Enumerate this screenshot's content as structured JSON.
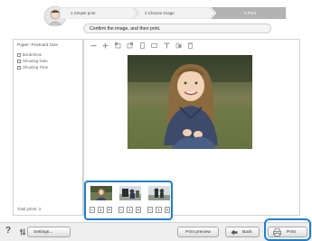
{
  "steps": [
    {
      "label": "1.Simple print"
    },
    {
      "label": "2.Choose image"
    },
    {
      "label": "3.Print"
    }
  ],
  "instruction": "Confirm the image, and then print.",
  "left_panel": {
    "paper_label": "Paper: Postcard Size",
    "options": [
      {
        "label": "Borderless"
      },
      {
        "label": "Shooting Date"
      },
      {
        "label": "Shooting Time"
      }
    ],
    "total_prints": "Total prints: 3"
  },
  "toolbar": {
    "icons": [
      "minus-icon",
      "plus-icon",
      "rotate-left-icon",
      "rotate-right-icon",
      "portrait-icon",
      "landscape-icon",
      "text-icon",
      "clip-icon",
      "trash-icon"
    ]
  },
  "thumbnails": [
    {
      "count": "1"
    },
    {
      "count": "1"
    },
    {
      "count": "1"
    }
  ],
  "stepper": {
    "minus": "−",
    "plus": "+"
  },
  "bottom": {
    "help": "?",
    "settings_label": "Settings...",
    "preview_label": "Print preview",
    "back_label": "Back",
    "print_label": "Print"
  },
  "colors": {
    "highlight": "#1d7fd0",
    "step_active": "#b3b3b3"
  }
}
